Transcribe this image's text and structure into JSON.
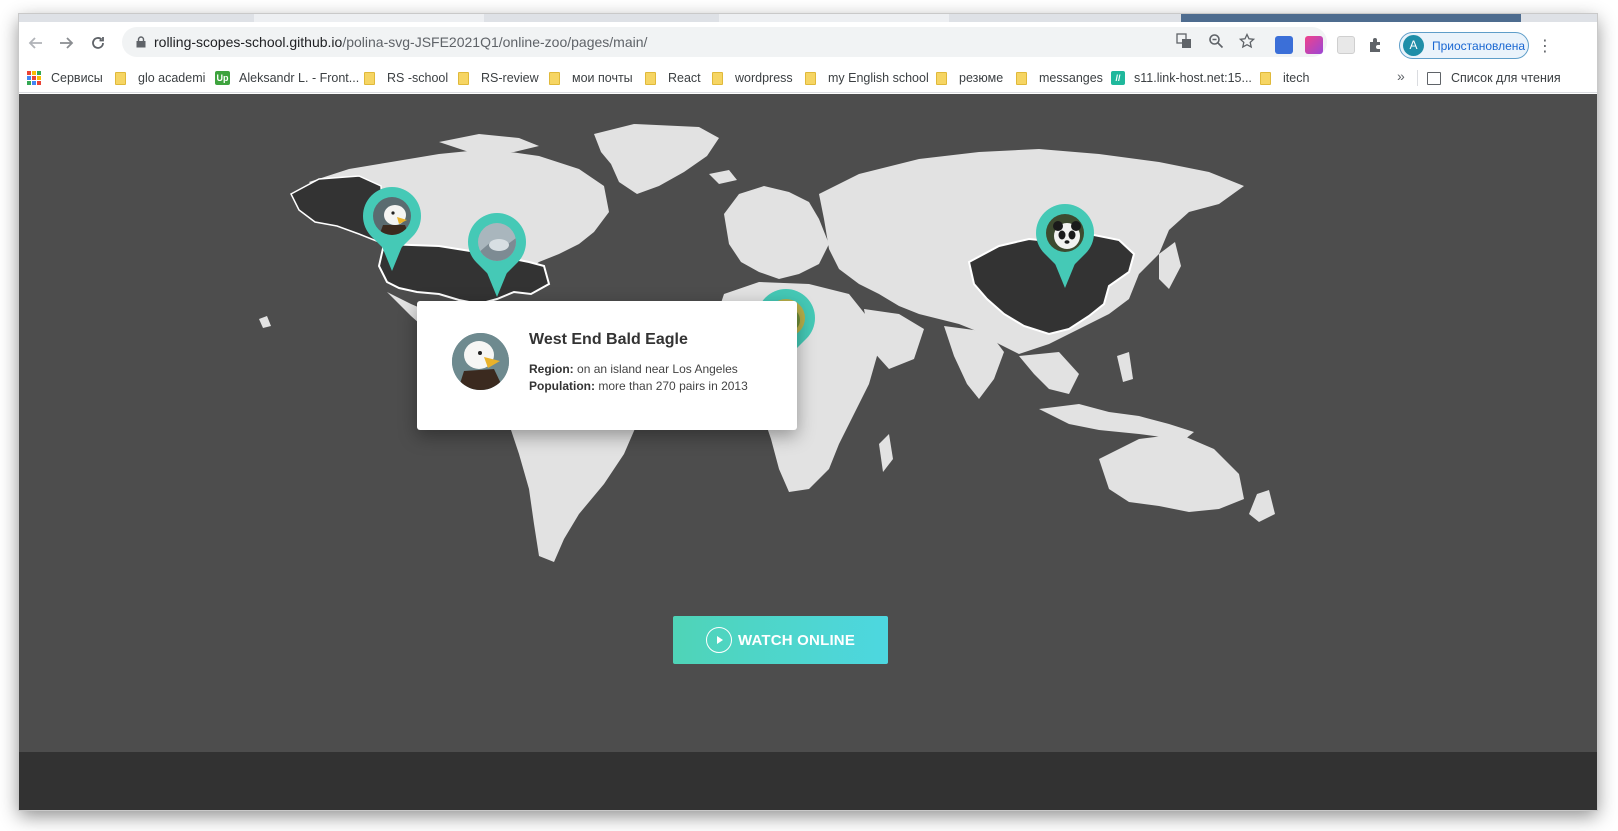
{
  "browser": {
    "url_host": "rolling-scopes-school.github.io",
    "url_path": "/polina-svg-JSFE2021Q1/online-zoo/pages/main/",
    "profile_initial": "A",
    "profile_label": "Приостановлена"
  },
  "bookmarks": [
    {
      "label": "Сервисы",
      "icon": "apps-grid-icon"
    },
    {
      "label": "glo academi",
      "icon": "folder-icon"
    },
    {
      "label": "Aleksandr L. - Front...",
      "icon": "upwork-icon",
      "badge": "Up"
    },
    {
      "label": "RS -school",
      "icon": "folder-icon"
    },
    {
      "label": "RS-review",
      "icon": "folder-icon"
    },
    {
      "label": "мои почты",
      "icon": "folder-icon"
    },
    {
      "label": "React",
      "icon": "folder-icon"
    },
    {
      "label": "wordpress",
      "icon": "folder-icon"
    },
    {
      "label": "my English school",
      "icon": "folder-icon"
    },
    {
      "label": "резюме",
      "icon": "folder-icon"
    },
    {
      "label": "messanges",
      "icon": "folder-icon"
    },
    {
      "label": "s11.link-host.net:15...",
      "icon": "link-host-icon",
      "badge": "//"
    },
    {
      "label": "itech",
      "icon": "folder-icon"
    }
  ],
  "reading_list": {
    "label": "Список для чтения"
  },
  "more_bookmarks": "»",
  "animal_card": {
    "title": "West End Bald Eagle",
    "region_label": "Region:",
    "region_value": "on an island near Los Angeles",
    "population_label": "Population:",
    "population_value": "more than 270 pairs in 2013"
  },
  "watch_button": {
    "label": "WATCH ONLINE"
  },
  "colors": {
    "page_bg": "#4d4d4d",
    "land": "#e2e2e2",
    "highlight_country": "#333333",
    "accent": "#45c9b6",
    "footer": "#323232"
  }
}
